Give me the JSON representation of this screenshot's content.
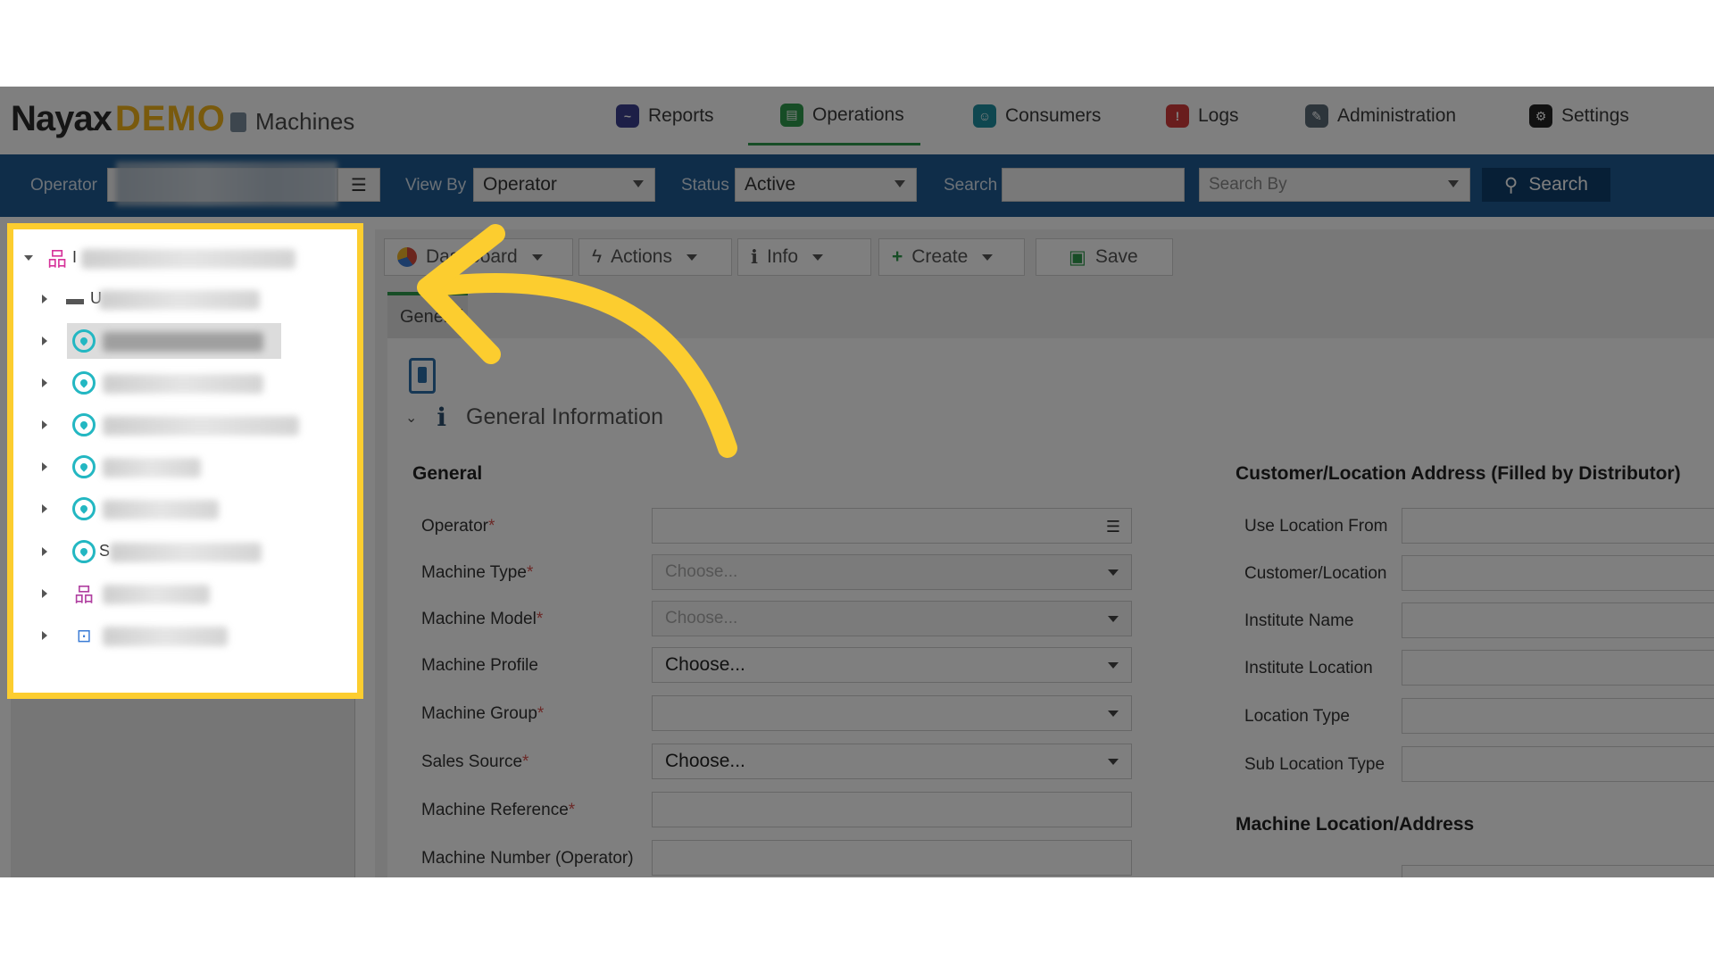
{
  "brand": {
    "name": "Nayax",
    "edition": "DEMO",
    "app": "Machines"
  },
  "nav": [
    {
      "label": "Reports",
      "color": "#3b3f8f"
    },
    {
      "label": "Operations",
      "color": "#2f9a4c"
    },
    {
      "label": "Consumers",
      "color": "#1f8fa0"
    },
    {
      "label": "Logs",
      "color": "#d23b3b"
    },
    {
      "label": "Administration",
      "color": "#5a6b77"
    },
    {
      "label": "Settings",
      "color": "#222222"
    }
  ],
  "filters": {
    "operator_label": "Operator",
    "viewby_label": "View By",
    "viewby_value": "Operator",
    "status_label": "Status",
    "status_value": "Active",
    "search_label": "Search",
    "searchby_placeholder": "Search By",
    "search_button": "Search"
  },
  "toolbar": {
    "dashboard": "Dashboard",
    "actions": "Actions",
    "info": "Info",
    "create": "Create",
    "save": "Save"
  },
  "subtab": "General",
  "section_title": "General Information",
  "general": {
    "title": "General",
    "fields": [
      {
        "label": "Operator",
        "required": "*",
        "value": "",
        "kind": "list"
      },
      {
        "label": "Machine Type",
        "required": "*",
        "value": "Choose...",
        "kind": "select-muted"
      },
      {
        "label": "Machine Model",
        "required": "*",
        "value": "Choose...",
        "kind": "select-muted"
      },
      {
        "label": "Machine Profile",
        "required": "",
        "value": "Choose...",
        "kind": "select"
      },
      {
        "label": "Machine Group",
        "required": "*",
        "value": "",
        "kind": "select"
      },
      {
        "label": "Sales Source",
        "required": "*",
        "value": "Choose...",
        "kind": "select"
      },
      {
        "label": "Machine Reference",
        "required": "*",
        "value": "",
        "kind": "text"
      },
      {
        "label": "Machine Number (Operator)",
        "required": "",
        "value": "",
        "kind": "text"
      }
    ]
  },
  "address": {
    "title": "Customer/Location Address (Filled by Distributor)",
    "fields": [
      {
        "label": "Use Location From"
      },
      {
        "label": "Customer/Location"
      },
      {
        "label": "Institute Name"
      },
      {
        "label": "Institute Location"
      },
      {
        "label": "Location Type"
      },
      {
        "label": "Sub Location Type"
      }
    ],
    "machine_location_title": "Machine Location/Address"
  },
  "tree": {
    "root_partial": "I",
    "folder_partial": "U",
    "item_partial": "S"
  },
  "colors": {
    "highlight": "#fccd2f",
    "header_blue": "#1f5b92",
    "accent_green": "#2f9a4c"
  }
}
